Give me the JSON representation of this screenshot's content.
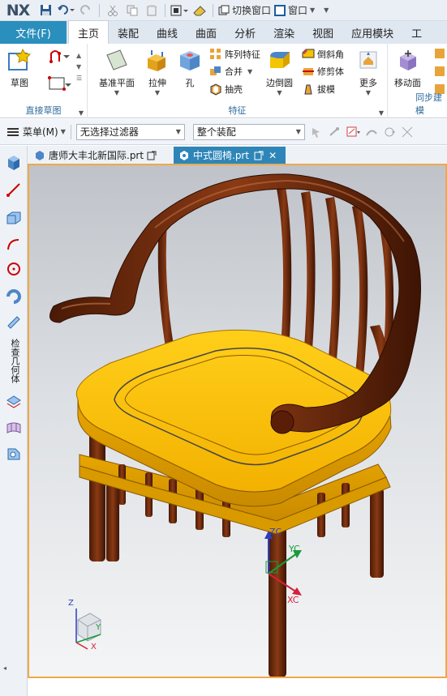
{
  "app": {
    "logo": "NX"
  },
  "quick_access": {
    "switch_window": "切换窗口",
    "window": "窗口"
  },
  "tabs": {
    "file": "文件(F)",
    "items": [
      "主页",
      "装配",
      "曲线",
      "曲面",
      "分析",
      "渲染",
      "视图",
      "应用模块",
      "工"
    ],
    "active_index": 0
  },
  "ribbon": {
    "sketch_group": {
      "label": "直接草图",
      "sketch": "草图"
    },
    "feature_group": {
      "label": "特征",
      "datum_plane": "基准平面",
      "extrude": "拉伸",
      "hole": "孔",
      "pattern_feature": "阵列特征",
      "unite": "合并",
      "shell": "抽壳",
      "edge_blend": "边倒圆",
      "chamfer": "倒斜角",
      "trim_body": "修剪体",
      "draft": "拔模",
      "more": "更多"
    },
    "sync_group": {
      "label": "同步建模",
      "move_face": "移动面"
    }
  },
  "command_bar": {
    "menu": "菜单(M)",
    "filter": "无选择过滤器",
    "scope": "整个装配"
  },
  "resource_bar": {
    "vertical_label": "检查几何体"
  },
  "doc_tabs": [
    {
      "name": "唐师大丰北新国际.prt",
      "active": false
    },
    {
      "name": "中式圆椅.prt",
      "active": true
    }
  ],
  "viewport": {
    "wcs": {
      "zc": "ZC",
      "yc": "YC",
      "xc": "XC"
    },
    "triad": {
      "z": "Z",
      "y": "Y",
      "x": "X"
    }
  },
  "colors": {
    "file_tab": "#2a8fbd",
    "active_doc_tab": "#2e86b8",
    "viewport_frame": "#f0a848",
    "seat": "#ffc400",
    "wood": "#6e2c0e"
  }
}
